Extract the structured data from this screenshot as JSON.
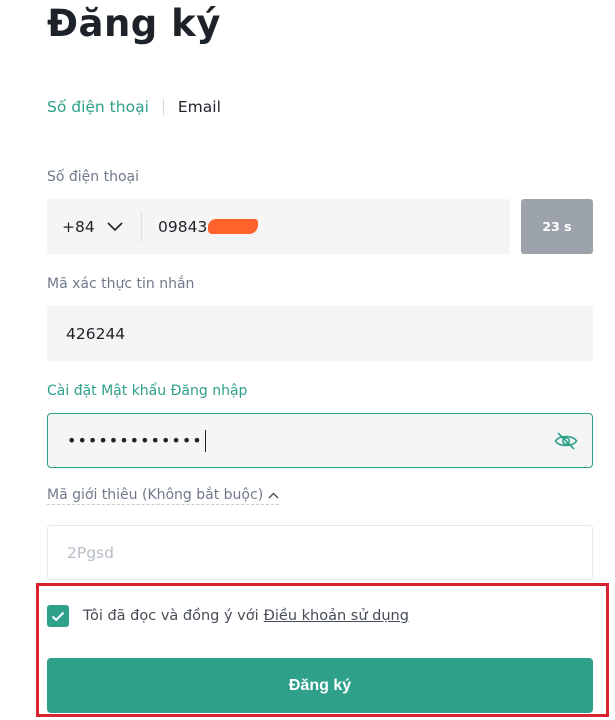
{
  "page": {
    "title": "Đăng ký"
  },
  "tabs": {
    "phone": "Số điện thoại",
    "email": "Email"
  },
  "phone": {
    "label": "Số điện thoại",
    "country_code": "+84",
    "value_visible": "09843",
    "timer": "23 s"
  },
  "otp": {
    "label": "Mã xác thực tin nhắn",
    "value": "426244"
  },
  "password": {
    "label": "Cài đặt Mật khẩu Đăng nhập",
    "value_masked": "•••••••••••••",
    "toggle_icon": "eye-off-icon"
  },
  "referral": {
    "label": "Mã giới thiêu (Không bắt buộc)",
    "placeholder": "2Pgsd"
  },
  "agreement": {
    "text": "Tôi đã đọc và đồng ý với",
    "link": "Điều khoản sử dụng",
    "checked": true
  },
  "submit": {
    "label": "Đăng ký"
  },
  "colors": {
    "accent": "#2fa08a",
    "highlight": "#d9242f",
    "timer_bg": "#9da3aa"
  }
}
